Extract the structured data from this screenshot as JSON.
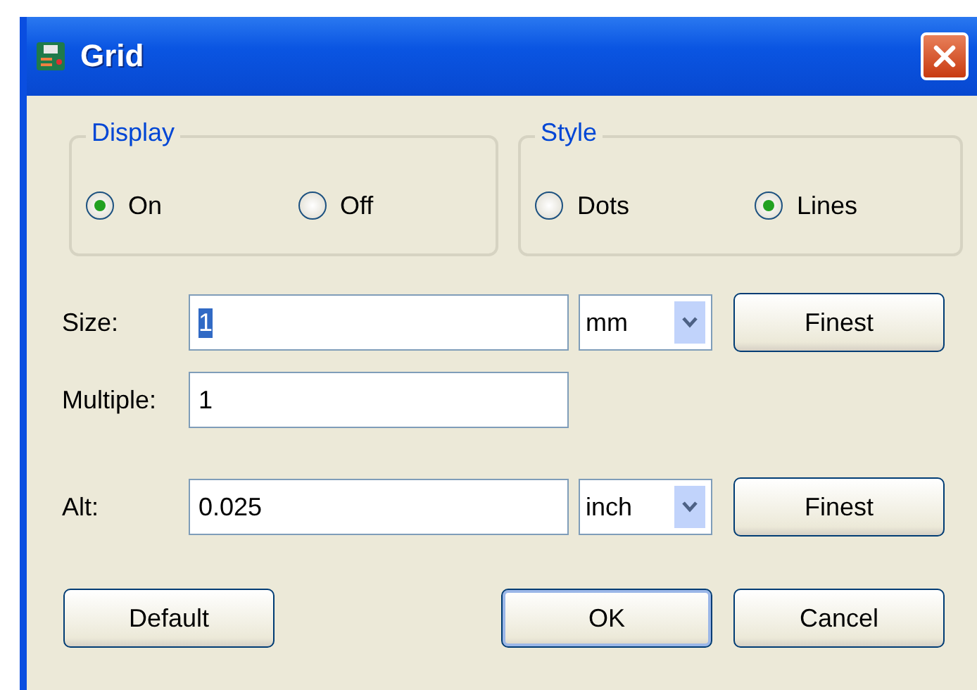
{
  "window": {
    "title": "Grid"
  },
  "groups": [
    {
      "title": "Display",
      "options": [
        {
          "label": "On",
          "selected": true
        },
        {
          "label": "Off",
          "selected": false
        }
      ]
    },
    {
      "title": "Style",
      "options": [
        {
          "label": "Dots",
          "selected": false
        },
        {
          "label": "Lines",
          "selected": true
        }
      ]
    }
  ],
  "fields": [
    {
      "label": "Size:",
      "value": "1",
      "value_selected": true,
      "unit": "mm",
      "button": "Finest"
    },
    {
      "label": "Multiple:",
      "value": "1",
      "value_selected": false
    },
    {
      "label": "Alt:",
      "value": "0.025",
      "value_selected": false,
      "unit": "inch",
      "button": "Finest"
    }
  ],
  "buttons": [
    {
      "label": "Default",
      "default": false
    },
    {
      "label": "OK",
      "default": true
    },
    {
      "label": "Cancel",
      "default": false
    }
  ]
}
